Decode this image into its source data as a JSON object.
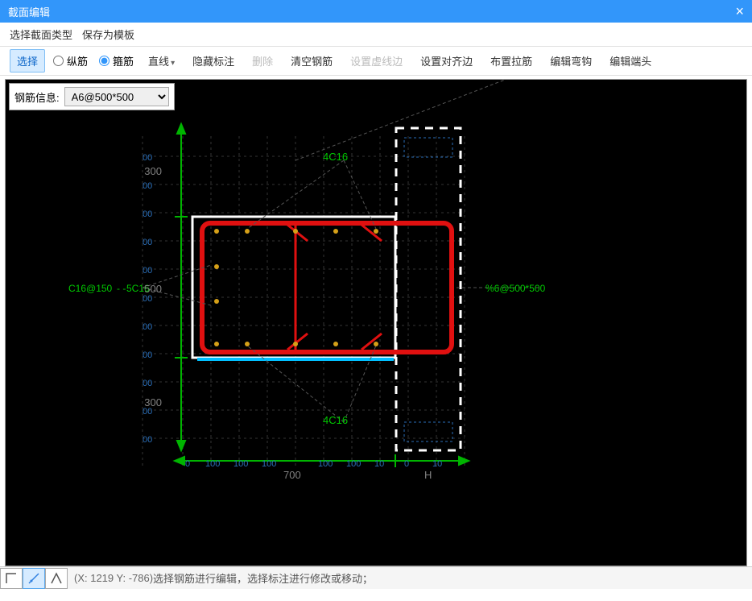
{
  "titlebar": {
    "title": "截面编辑"
  },
  "menubar": {
    "choose_type": "选择截面类型",
    "save_tpl": "保存为模板"
  },
  "toolbar": {
    "select": "选择",
    "longitudinal": "纵筋",
    "stirrup": "箍筋",
    "line": "直线",
    "hide_label": "隐藏标注",
    "delete": "删除",
    "clear_rebar": "清空钢筋",
    "set_dashed": "设置虚线边",
    "set_align": "设置对齐边",
    "arrange_tie": "布置拉筋",
    "edit_hook": "编辑弯钩",
    "edit_end": "编辑端头"
  },
  "info": {
    "label": "钢筋信息:",
    "value": "A6@500*500"
  },
  "annotations": {
    "top_rebar": "4C16",
    "bottom_rebar": "4C16",
    "left_rebar": "C16@150",
    "left_rebar_num": "5C16",
    "right_stirrup": "%6@500*500",
    "dim_300_1": "300",
    "dim_300_2": "300",
    "dim_700": "700",
    "dim_500": "500",
    "H": "H",
    "tick_00": "00",
    "tick_100": "100"
  },
  "status": {
    "coords": "(X: 1219 Y: -786)",
    "hint": "选择钢筋进行编辑，选择标注进行修改或移动；"
  }
}
